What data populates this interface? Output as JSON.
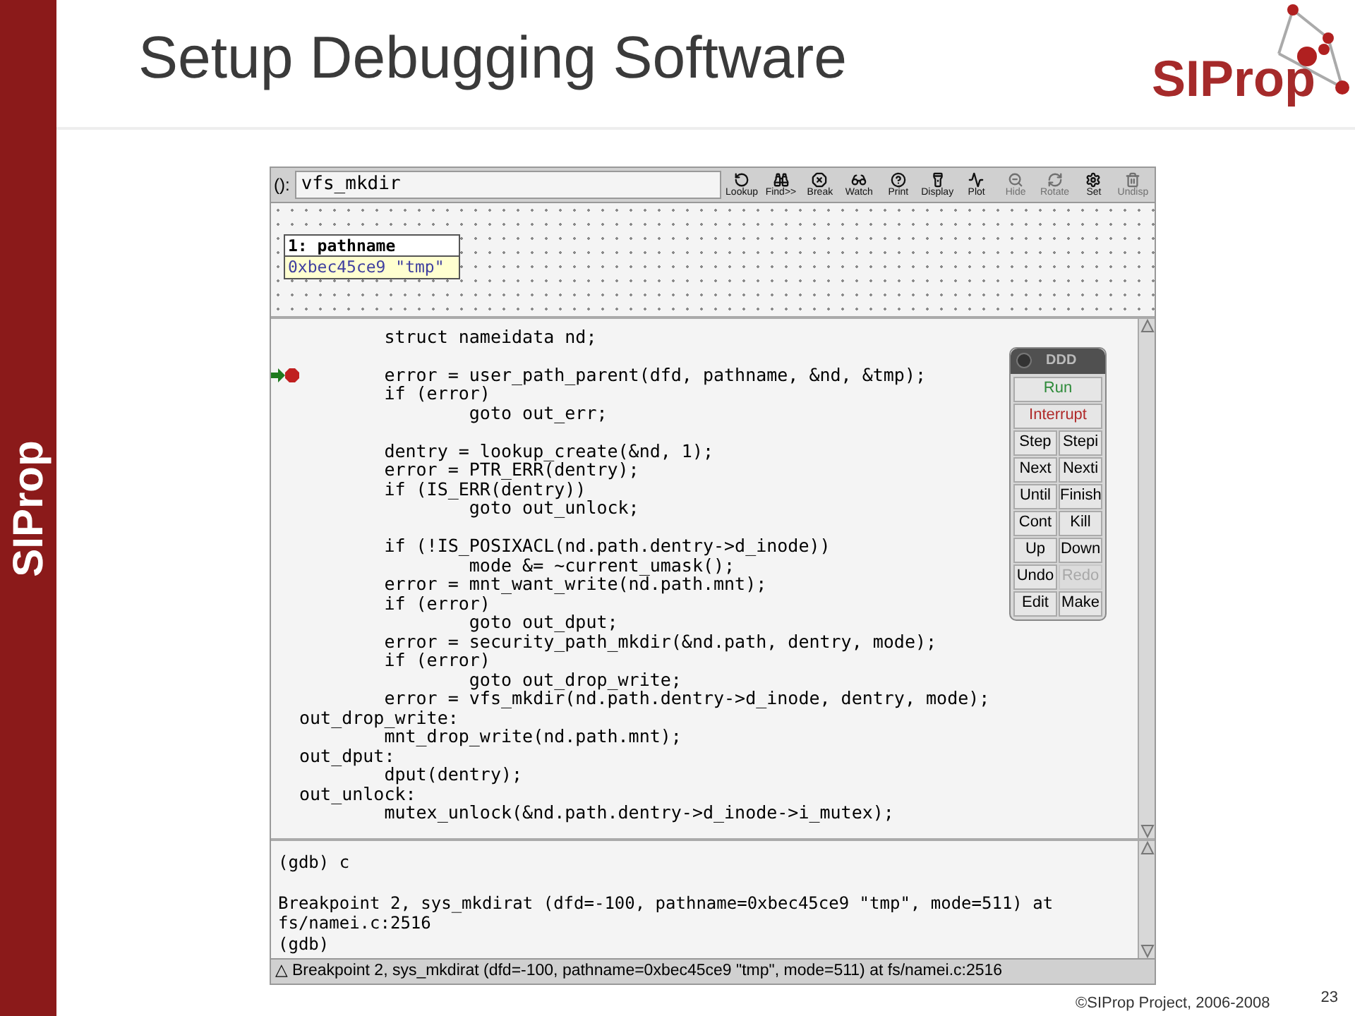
{
  "slide": {
    "title": "Setup Debugging Software",
    "side_logo": "SIProp",
    "logo": "SIProp",
    "footer": "©SIProp Project, 2006-2008",
    "page_number": "23"
  },
  "ddd": {
    "argument_label": "():",
    "argument": "vfs_mkdir",
    "toolbar": [
      {
        "kind": "lookup",
        "label": "Lookup",
        "disabled": false
      },
      {
        "kind": "find",
        "label": "Find>>",
        "disabled": false
      },
      {
        "kind": "break",
        "label": "Break",
        "disabled": false
      },
      {
        "kind": "watch",
        "label": "Watch",
        "disabled": false
      },
      {
        "kind": "print",
        "label": "Print",
        "disabled": false
      },
      {
        "kind": "display",
        "label": "Display",
        "disabled": false
      },
      {
        "kind": "plot",
        "label": "Plot",
        "disabled": false
      },
      {
        "kind": "hide",
        "label": "Hide",
        "disabled": true
      },
      {
        "kind": "rotate",
        "label": "Rotate",
        "disabled": true
      },
      {
        "kind": "set",
        "label": "Set",
        "disabled": false
      },
      {
        "kind": "undisp",
        "label": "Undisp",
        "disabled": true
      }
    ],
    "display": {
      "title": "1: pathname",
      "value": "0xbec45ce9 \"tmp\""
    },
    "source": [
      {
        "text": "        struct nameidata nd;",
        "blank_before": false,
        "breakpoint": false
      },
      {
        "text": "        error = user_path_parent(dfd, pathname, &nd, &tmp);",
        "blank_before": true,
        "breakpoint": true
      },
      {
        "text": "        if (error)",
        "blank_before": false,
        "breakpoint": false
      },
      {
        "text": "                goto out_err;",
        "blank_before": false,
        "breakpoint": false
      },
      {
        "text": "        dentry = lookup_create(&nd, 1);",
        "blank_before": true,
        "breakpoint": false
      },
      {
        "text": "        error = PTR_ERR(dentry);",
        "blank_before": false,
        "breakpoint": false
      },
      {
        "text": "        if (IS_ERR(dentry))",
        "blank_before": false,
        "breakpoint": false
      },
      {
        "text": "                goto out_unlock;",
        "blank_before": false,
        "breakpoint": false
      },
      {
        "text": "        if (!IS_POSIXACL(nd.path.dentry->d_inode))",
        "blank_before": true,
        "breakpoint": false
      },
      {
        "text": "                mode &= ~current_umask();",
        "blank_before": false,
        "breakpoint": false
      },
      {
        "text": "        error = mnt_want_write(nd.path.mnt);",
        "blank_before": false,
        "breakpoint": false
      },
      {
        "text": "        if (error)",
        "blank_before": false,
        "breakpoint": false
      },
      {
        "text": "                goto out_dput;",
        "blank_before": false,
        "breakpoint": false
      },
      {
        "text": "        error = security_path_mkdir(&nd.path, dentry, mode);",
        "blank_before": false,
        "breakpoint": false
      },
      {
        "text": "        if (error)",
        "blank_before": false,
        "breakpoint": false
      },
      {
        "text": "                goto out_drop_write;",
        "blank_before": false,
        "breakpoint": false
      },
      {
        "text": "        error = vfs_mkdir(nd.path.dentry->d_inode, dentry, mode);",
        "blank_before": false,
        "breakpoint": false
      },
      {
        "text": "out_drop_write:",
        "blank_before": false,
        "breakpoint": false
      },
      {
        "text": "        mnt_drop_write(nd.path.mnt);",
        "blank_before": false,
        "breakpoint": false
      },
      {
        "text": "out_dput:",
        "blank_before": false,
        "breakpoint": false
      },
      {
        "text": "        dput(dentry);",
        "blank_before": false,
        "breakpoint": false
      },
      {
        "text": "out_unlock:",
        "blank_before": false,
        "breakpoint": false
      },
      {
        "text": "        mutex_unlock(&nd.path.dentry->d_inode->i_mutex);",
        "blank_before": false,
        "breakpoint": false
      }
    ],
    "command_tool": {
      "title": "DDD",
      "commands": [
        {
          "label": "Run",
          "wide": true,
          "disabled": false,
          "color": "#2e8b3a"
        },
        {
          "label": "Interrupt",
          "wide": true,
          "disabled": false,
          "color": "#b02a2a"
        },
        {
          "label": "Step",
          "wide": false,
          "disabled": false,
          "color": "#000000"
        },
        {
          "label": "Stepi",
          "wide": false,
          "disabled": false,
          "color": "#000000"
        },
        {
          "label": "Next",
          "wide": false,
          "disabled": false,
          "color": "#000000"
        },
        {
          "label": "Nexti",
          "wide": false,
          "disabled": false,
          "color": "#000000"
        },
        {
          "label": "Until",
          "wide": false,
          "disabled": false,
          "color": "#000000"
        },
        {
          "label": "Finish",
          "wide": false,
          "disabled": false,
          "color": "#000000"
        },
        {
          "label": "Cont",
          "wide": false,
          "disabled": false,
          "color": "#000000"
        },
        {
          "label": "Kill",
          "wide": false,
          "disabled": false,
          "color": "#000000"
        },
        {
          "label": "Up",
          "wide": false,
          "disabled": false,
          "color": "#000000"
        },
        {
          "label": "Down",
          "wide": false,
          "disabled": false,
          "color": "#000000"
        },
        {
          "label": "Undo",
          "wide": false,
          "disabled": false,
          "color": "#000000"
        },
        {
          "label": "Redo",
          "wide": false,
          "disabled": true,
          "color": "#a8a8a8"
        },
        {
          "label": "Edit",
          "wide": false,
          "disabled": false,
          "color": "#000000"
        },
        {
          "label": "Make",
          "wide": false,
          "disabled": false,
          "color": "#000000"
        }
      ]
    },
    "console": [
      {
        "text": "(gdb) c",
        "blank_before": false
      },
      {
        "text": "Breakpoint 2, sys_mkdirat (dfd=-100, pathname=0xbec45ce9 \"tmp\", mode=511) at",
        "blank_before": true
      },
      {
        "text": "fs/namei.c:2516",
        "blank_before": false
      },
      {
        "text": "(gdb)",
        "blank_before": false
      }
    ],
    "status_icon": "△",
    "status": "Breakpoint 2, sys_mkdirat (dfd=-100, pathname=0xbec45ce9 \"tmp\", mode=511) at fs/namei.c:2516"
  }
}
